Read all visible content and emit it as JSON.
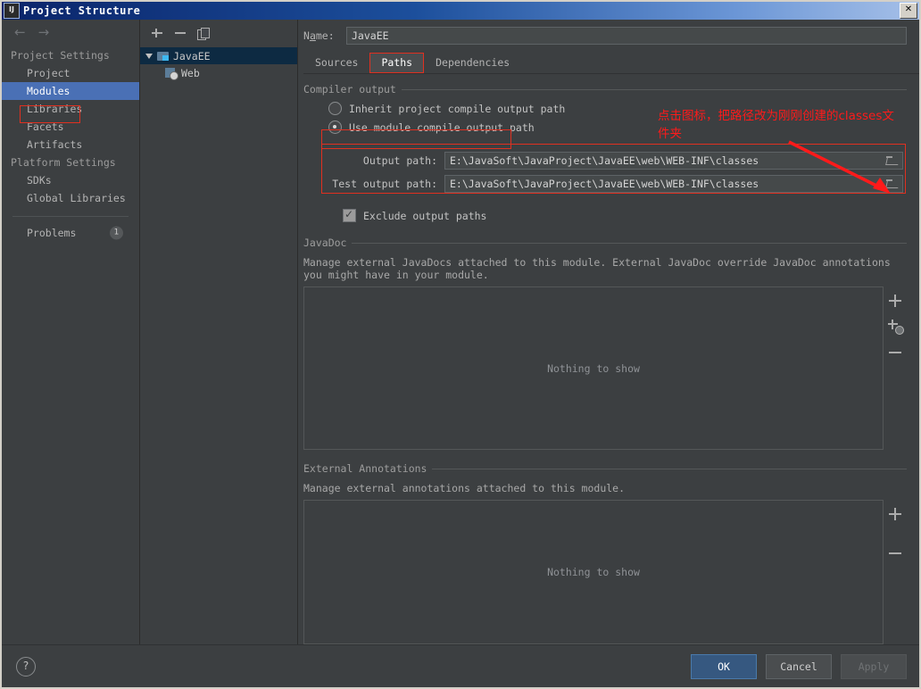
{
  "window": {
    "title": "Project Structure",
    "app_icon": "IJ",
    "close_label": "✕"
  },
  "sidebar": {
    "back_icon": "←",
    "forward_icon": "→",
    "groups": [
      {
        "label": "Project Settings",
        "items": [
          {
            "label": "Project",
            "selected": false
          },
          {
            "label": "Modules",
            "selected": true
          },
          {
            "label": "Libraries",
            "selected": false
          },
          {
            "label": "Facets",
            "selected": false
          },
          {
            "label": "Artifacts",
            "selected": false
          }
        ]
      },
      {
        "label": "Platform Settings",
        "items": [
          {
            "label": "SDKs",
            "selected": false
          },
          {
            "label": "Global Libraries",
            "selected": false
          }
        ]
      }
    ],
    "problems": {
      "label": "Problems",
      "badge": "1"
    }
  },
  "tree": {
    "toolbar": {
      "add": "+",
      "remove": "−",
      "copy": "copy"
    },
    "nodes": [
      {
        "label": "JavaEE",
        "selected": true,
        "icon": "module-folder-icon"
      },
      {
        "label": "Web",
        "selected": false,
        "icon": "web-facet-icon"
      }
    ]
  },
  "module": {
    "name_label": "Name:",
    "name_value": "JavaEE",
    "tabs": [
      {
        "label": "Sources",
        "active": false
      },
      {
        "label": "Paths",
        "active": true
      },
      {
        "label": "Dependencies",
        "active": false
      }
    ]
  },
  "compiler_output": {
    "group_title": "Compiler output",
    "options": [
      {
        "label": "Inherit project compile output path",
        "checked": false
      },
      {
        "label": "Use module compile output path",
        "checked": true
      }
    ],
    "output_path": {
      "label": "Output path:",
      "value": "E:\\JavaSoft\\JavaProject\\JavaEE\\web\\WEB-INF\\classes"
    },
    "test_output_path": {
      "label": "Test output path:",
      "value": "E:\\JavaSoft\\JavaProject\\JavaEE\\web\\WEB-INF\\classes"
    },
    "exclude": {
      "label": "Exclude output paths",
      "checked": true
    }
  },
  "javadoc": {
    "group_title": "JavaDoc",
    "description": "Manage external JavaDocs attached to this module. External JavaDoc override JavaDoc annotations you might have in your module.",
    "empty_text": "Nothing to show",
    "tools": {
      "add": "+",
      "add_url": "add-url",
      "remove": "−"
    }
  },
  "external_annotations": {
    "group_title": "External Annotations",
    "description": "Manage external annotations attached to this module.",
    "empty_text": "Nothing to show",
    "tools": {
      "add": "+",
      "remove": "−"
    }
  },
  "annotation": {
    "text": "点击图标，把路径改为刚刚创建的classes文件夹",
    "color": "#ff1a1a"
  },
  "footer": {
    "help": "?",
    "ok": "OK",
    "cancel": "Cancel",
    "apply": "Apply"
  }
}
